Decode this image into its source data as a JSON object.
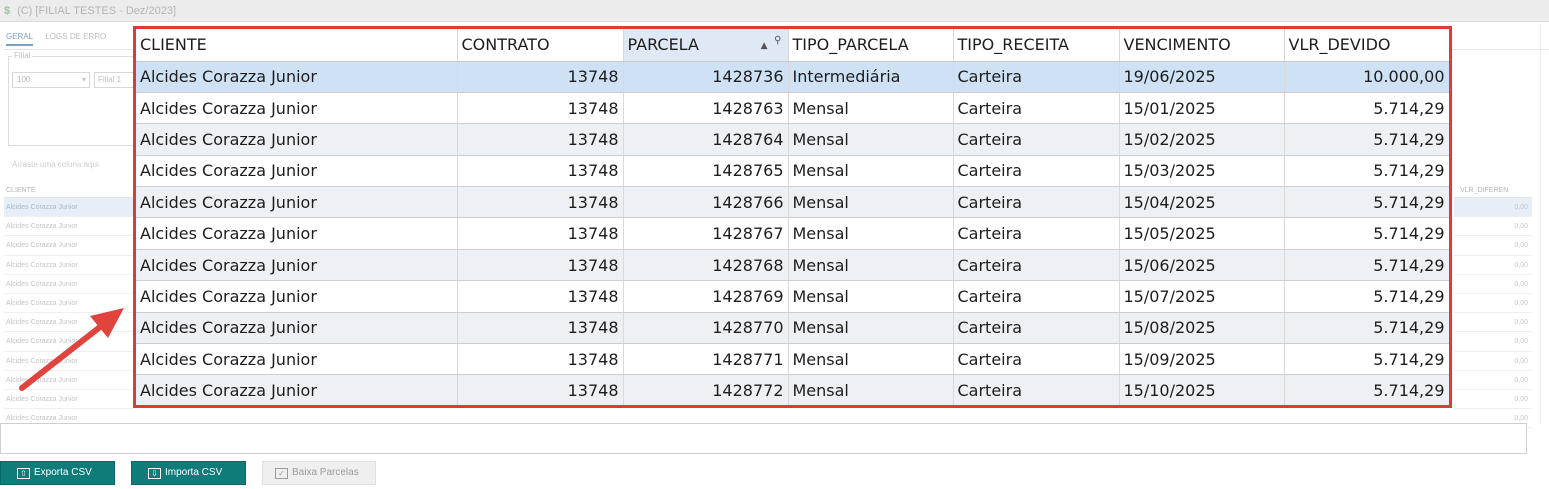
{
  "window": {
    "title": "(C) [FILIAL TESTES - Dez/2023]"
  },
  "background": {
    "tabs": [
      "GERAL",
      "LOGS DE ERRO"
    ],
    "filial_legend": "Filial",
    "filial_value": "100",
    "filial_button": "Filial 1",
    "group_hint": "Arraste uma coluna aqui",
    "grid_header": "CLIENTE",
    "grid_rows": [
      "Alcides Corazza Junior",
      "Alcides Corazza Junior",
      "Alcides Corazza Junior",
      "Alcides Corazza Junior",
      "Alcides Corazza Junior",
      "Alcides Corazza Junior",
      "Alcides Corazza Junior",
      "Alcides Corazza Junior",
      "Alcides Corazza Junior",
      "Alcides Corazza Junior",
      "Alcides Corazza Junior",
      "Alcides Corazza Junior"
    ],
    "right_header": "VLR_DIFEREN",
    "right_values": [
      "0,00",
      "0,00",
      "0,00",
      "0,00",
      "0,00",
      "0,00",
      "0,00",
      "0,00",
      "0,00",
      "0,00",
      "0,00",
      "0,00"
    ]
  },
  "grid": {
    "columns": [
      "CLIENTE",
      "CONTRATO",
      "PARCELA",
      "TIPO_PARCELA",
      "TIPO_RECEITA",
      "VENCIMENTO",
      "VLR_DEVIDO"
    ],
    "sorted_column": "PARCELA",
    "rows": [
      {
        "cliente": "Alcides Corazza Junior",
        "contrato": "13748",
        "parcela": "1428736",
        "tipo_parcela": "Intermediária",
        "tipo_receita": "Carteira",
        "vencimento": "19/06/2025",
        "vlr_devido": "10.000,00"
      },
      {
        "cliente": "Alcides Corazza Junior",
        "contrato": "13748",
        "parcela": "1428763",
        "tipo_parcela": "Mensal",
        "tipo_receita": "Carteira",
        "vencimento": "15/01/2025",
        "vlr_devido": "5.714,29"
      },
      {
        "cliente": "Alcides Corazza Junior",
        "contrato": "13748",
        "parcela": "1428764",
        "tipo_parcela": "Mensal",
        "tipo_receita": "Carteira",
        "vencimento": "15/02/2025",
        "vlr_devido": "5.714,29"
      },
      {
        "cliente": "Alcides Corazza Junior",
        "contrato": "13748",
        "parcela": "1428765",
        "tipo_parcela": "Mensal",
        "tipo_receita": "Carteira",
        "vencimento": "15/03/2025",
        "vlr_devido": "5.714,29"
      },
      {
        "cliente": "Alcides Corazza Junior",
        "contrato": "13748",
        "parcela": "1428766",
        "tipo_parcela": "Mensal",
        "tipo_receita": "Carteira",
        "vencimento": "15/04/2025",
        "vlr_devido": "5.714,29"
      },
      {
        "cliente": "Alcides Corazza Junior",
        "contrato": "13748",
        "parcela": "1428767",
        "tipo_parcela": "Mensal",
        "tipo_receita": "Carteira",
        "vencimento": "15/05/2025",
        "vlr_devido": "5.714,29"
      },
      {
        "cliente": "Alcides Corazza Junior",
        "contrato": "13748",
        "parcela": "1428768",
        "tipo_parcela": "Mensal",
        "tipo_receita": "Carteira",
        "vencimento": "15/06/2025",
        "vlr_devido": "5.714,29"
      },
      {
        "cliente": "Alcides Corazza Junior",
        "contrato": "13748",
        "parcela": "1428769",
        "tipo_parcela": "Mensal",
        "tipo_receita": "Carteira",
        "vencimento": "15/07/2025",
        "vlr_devido": "5.714,29"
      },
      {
        "cliente": "Alcides Corazza Junior",
        "contrato": "13748",
        "parcela": "1428770",
        "tipo_parcela": "Mensal",
        "tipo_receita": "Carteira",
        "vencimento": "15/08/2025",
        "vlr_devido": "5.714,29"
      },
      {
        "cliente": "Alcides Corazza Junior",
        "contrato": "13748",
        "parcela": "1428771",
        "tipo_parcela": "Mensal",
        "tipo_receita": "Carteira",
        "vencimento": "15/09/2025",
        "vlr_devido": "5.714,29"
      },
      {
        "cliente": "Alcides Corazza Junior",
        "contrato": "13748",
        "parcela": "1428772",
        "tipo_parcela": "Mensal",
        "tipo_receita": "Carteira",
        "vencimento": "15/10/2025",
        "vlr_devido": "5.714,29"
      }
    ]
  },
  "buttons": {
    "exporta": "Exporta CSV",
    "importa": "Importa CSV",
    "baixa": "Baixa Parcelas"
  },
  "icons": {
    "sort": "sort-ascending-icon",
    "filter": "filter-icon",
    "export": "export-icon",
    "import": "import-icon",
    "baixa": "checklist-icon"
  },
  "colors": {
    "highlight_border": "#dd3c34",
    "button_teal": "#0f7c7a",
    "selected_row": "#cfe2f5"
  }
}
